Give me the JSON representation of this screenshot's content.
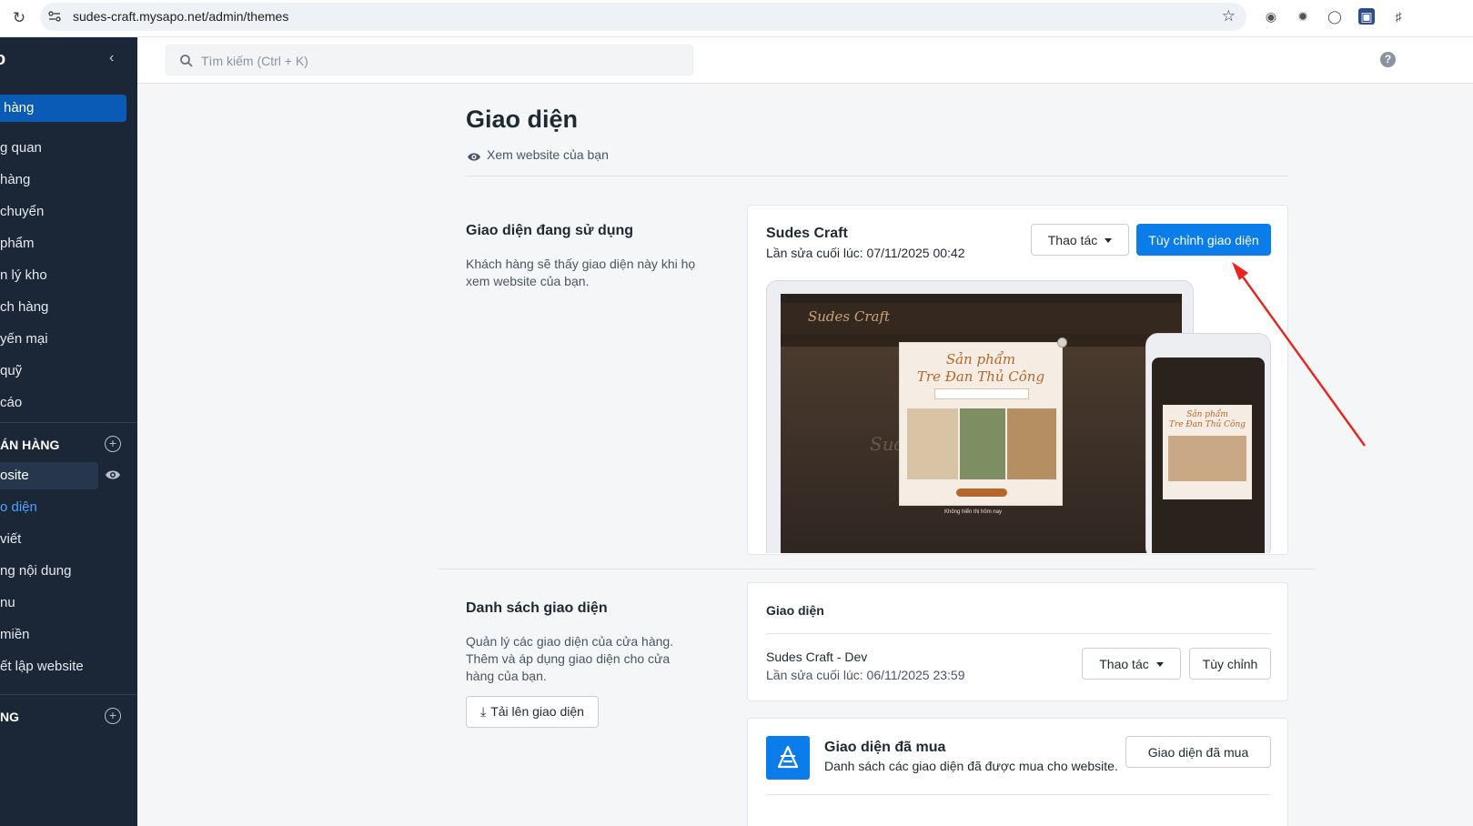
{
  "browser": {
    "url": "sudes-craft.mysapo.net/admin/themes"
  },
  "sidebar": {
    "logo": "o",
    "active_item": "hàng",
    "items": [
      "g quan",
      "hàng",
      "chuyển",
      "phẩm",
      "n lý kho",
      "ch hàng",
      "yến mại",
      "quỹ",
      "cáo"
    ],
    "section_sales": "ÁN HÀNG",
    "website_label": "osite",
    "sub_items": [
      "o diện",
      "viết",
      "ng nội dung",
      "nu",
      "miền",
      "ết lập website"
    ],
    "section_more": "NG"
  },
  "search": {
    "placeholder": "Tìm kiếm (Ctrl + K)"
  },
  "page": {
    "title": "Giao diện",
    "view_site": "Xem website của bạn"
  },
  "current_theme": {
    "section_title": "Giao diện đang sử dụng",
    "section_desc_1": "Khách hàng sẽ thấy giao diện này khi họ",
    "section_desc_2": "xem website của bạn.",
    "name": "Sudes Craft",
    "last_edited": "Lần sửa cuối lúc: 07/11/2025 00:42",
    "actions_button": "Thao tác",
    "customize_button": "Tùy chỉnh giao diện",
    "preview": {
      "logo": "Sudes Craft",
      "popup_title_1": "Sản phẩm",
      "popup_title_2": "Tre Đan Thủ Công",
      "hero_text": "Sud",
      "popup_checkbox": "Không hiển thị hôm nay"
    }
  },
  "theme_list": {
    "section_title": "Danh sách giao diện",
    "section_desc_1": "Quản lý các giao diện của cửa hàng.",
    "section_desc_2": "Thêm và áp dụng giao diện cho cửa",
    "section_desc_3": "hàng của bạn.",
    "upload_button": "Tải lên giao diện",
    "card_header": "Giao diện",
    "theme_name": "Sudes Craft - Dev",
    "theme_last_edited": "Lần sửa cuối lúc: 06/11/2025 23:59",
    "actions_button": "Thao tác",
    "customize_button": "Tùy chỉnh"
  },
  "purchased": {
    "title": "Giao diện đã mua",
    "desc": "Danh sách các giao diện đã được mua cho website.",
    "button": "Giao diện đã mua"
  },
  "colors": {
    "sidebar_bg": "#1b2637",
    "primary": "#0a7dea",
    "annotation_arrow": "#e8241c"
  }
}
